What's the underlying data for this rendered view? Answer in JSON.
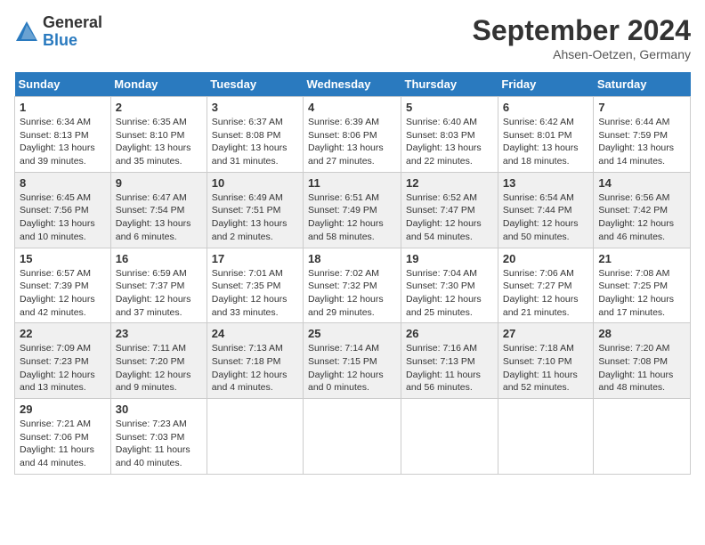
{
  "header": {
    "logo": {
      "general": "General",
      "blue": "Blue"
    },
    "title": "September 2024",
    "location": "Ahsen-Oetzen, Germany"
  },
  "weekdays": [
    "Sunday",
    "Monday",
    "Tuesday",
    "Wednesday",
    "Thursday",
    "Friday",
    "Saturday"
  ],
  "weeks": [
    [
      {
        "day": "1",
        "sunrise": "Sunrise: 6:34 AM",
        "sunset": "Sunset: 8:13 PM",
        "daylight": "Daylight: 13 hours and 39 minutes."
      },
      {
        "day": "2",
        "sunrise": "Sunrise: 6:35 AM",
        "sunset": "Sunset: 8:10 PM",
        "daylight": "Daylight: 13 hours and 35 minutes."
      },
      {
        "day": "3",
        "sunrise": "Sunrise: 6:37 AM",
        "sunset": "Sunset: 8:08 PM",
        "daylight": "Daylight: 13 hours and 31 minutes."
      },
      {
        "day": "4",
        "sunrise": "Sunrise: 6:39 AM",
        "sunset": "Sunset: 8:06 PM",
        "daylight": "Daylight: 13 hours and 27 minutes."
      },
      {
        "day": "5",
        "sunrise": "Sunrise: 6:40 AM",
        "sunset": "Sunset: 8:03 PM",
        "daylight": "Daylight: 13 hours and 22 minutes."
      },
      {
        "day": "6",
        "sunrise": "Sunrise: 6:42 AM",
        "sunset": "Sunset: 8:01 PM",
        "daylight": "Daylight: 13 hours and 18 minutes."
      },
      {
        "day": "7",
        "sunrise": "Sunrise: 6:44 AM",
        "sunset": "Sunset: 7:59 PM",
        "daylight": "Daylight: 13 hours and 14 minutes."
      }
    ],
    [
      {
        "day": "8",
        "sunrise": "Sunrise: 6:45 AM",
        "sunset": "Sunset: 7:56 PM",
        "daylight": "Daylight: 13 hours and 10 minutes."
      },
      {
        "day": "9",
        "sunrise": "Sunrise: 6:47 AM",
        "sunset": "Sunset: 7:54 PM",
        "daylight": "Daylight: 13 hours and 6 minutes."
      },
      {
        "day": "10",
        "sunrise": "Sunrise: 6:49 AM",
        "sunset": "Sunset: 7:51 PM",
        "daylight": "Daylight: 13 hours and 2 minutes."
      },
      {
        "day": "11",
        "sunrise": "Sunrise: 6:51 AM",
        "sunset": "Sunset: 7:49 PM",
        "daylight": "Daylight: 12 hours and 58 minutes."
      },
      {
        "day": "12",
        "sunrise": "Sunrise: 6:52 AM",
        "sunset": "Sunset: 7:47 PM",
        "daylight": "Daylight: 12 hours and 54 minutes."
      },
      {
        "day": "13",
        "sunrise": "Sunrise: 6:54 AM",
        "sunset": "Sunset: 7:44 PM",
        "daylight": "Daylight: 12 hours and 50 minutes."
      },
      {
        "day": "14",
        "sunrise": "Sunrise: 6:56 AM",
        "sunset": "Sunset: 7:42 PM",
        "daylight": "Daylight: 12 hours and 46 minutes."
      }
    ],
    [
      {
        "day": "15",
        "sunrise": "Sunrise: 6:57 AM",
        "sunset": "Sunset: 7:39 PM",
        "daylight": "Daylight: 12 hours and 42 minutes."
      },
      {
        "day": "16",
        "sunrise": "Sunrise: 6:59 AM",
        "sunset": "Sunset: 7:37 PM",
        "daylight": "Daylight: 12 hours and 37 minutes."
      },
      {
        "day": "17",
        "sunrise": "Sunrise: 7:01 AM",
        "sunset": "Sunset: 7:35 PM",
        "daylight": "Daylight: 12 hours and 33 minutes."
      },
      {
        "day": "18",
        "sunrise": "Sunrise: 7:02 AM",
        "sunset": "Sunset: 7:32 PM",
        "daylight": "Daylight: 12 hours and 29 minutes."
      },
      {
        "day": "19",
        "sunrise": "Sunrise: 7:04 AM",
        "sunset": "Sunset: 7:30 PM",
        "daylight": "Daylight: 12 hours and 25 minutes."
      },
      {
        "day": "20",
        "sunrise": "Sunrise: 7:06 AM",
        "sunset": "Sunset: 7:27 PM",
        "daylight": "Daylight: 12 hours and 21 minutes."
      },
      {
        "day": "21",
        "sunrise": "Sunrise: 7:08 AM",
        "sunset": "Sunset: 7:25 PM",
        "daylight": "Daylight: 12 hours and 17 minutes."
      }
    ],
    [
      {
        "day": "22",
        "sunrise": "Sunrise: 7:09 AM",
        "sunset": "Sunset: 7:23 PM",
        "daylight": "Daylight: 12 hours and 13 minutes."
      },
      {
        "day": "23",
        "sunrise": "Sunrise: 7:11 AM",
        "sunset": "Sunset: 7:20 PM",
        "daylight": "Daylight: 12 hours and 9 minutes."
      },
      {
        "day": "24",
        "sunrise": "Sunrise: 7:13 AM",
        "sunset": "Sunset: 7:18 PM",
        "daylight": "Daylight: 12 hours and 4 minutes."
      },
      {
        "day": "25",
        "sunrise": "Sunrise: 7:14 AM",
        "sunset": "Sunset: 7:15 PM",
        "daylight": "Daylight: 12 hours and 0 minutes."
      },
      {
        "day": "26",
        "sunrise": "Sunrise: 7:16 AM",
        "sunset": "Sunset: 7:13 PM",
        "daylight": "Daylight: 11 hours and 56 minutes."
      },
      {
        "day": "27",
        "sunrise": "Sunrise: 7:18 AM",
        "sunset": "Sunset: 7:10 PM",
        "daylight": "Daylight: 11 hours and 52 minutes."
      },
      {
        "day": "28",
        "sunrise": "Sunrise: 7:20 AM",
        "sunset": "Sunset: 7:08 PM",
        "daylight": "Daylight: 11 hours and 48 minutes."
      }
    ],
    [
      {
        "day": "29",
        "sunrise": "Sunrise: 7:21 AM",
        "sunset": "Sunset: 7:06 PM",
        "daylight": "Daylight: 11 hours and 44 minutes."
      },
      {
        "day": "30",
        "sunrise": "Sunrise: 7:23 AM",
        "sunset": "Sunset: 7:03 PM",
        "daylight": "Daylight: 11 hours and 40 minutes."
      },
      null,
      null,
      null,
      null,
      null
    ]
  ]
}
